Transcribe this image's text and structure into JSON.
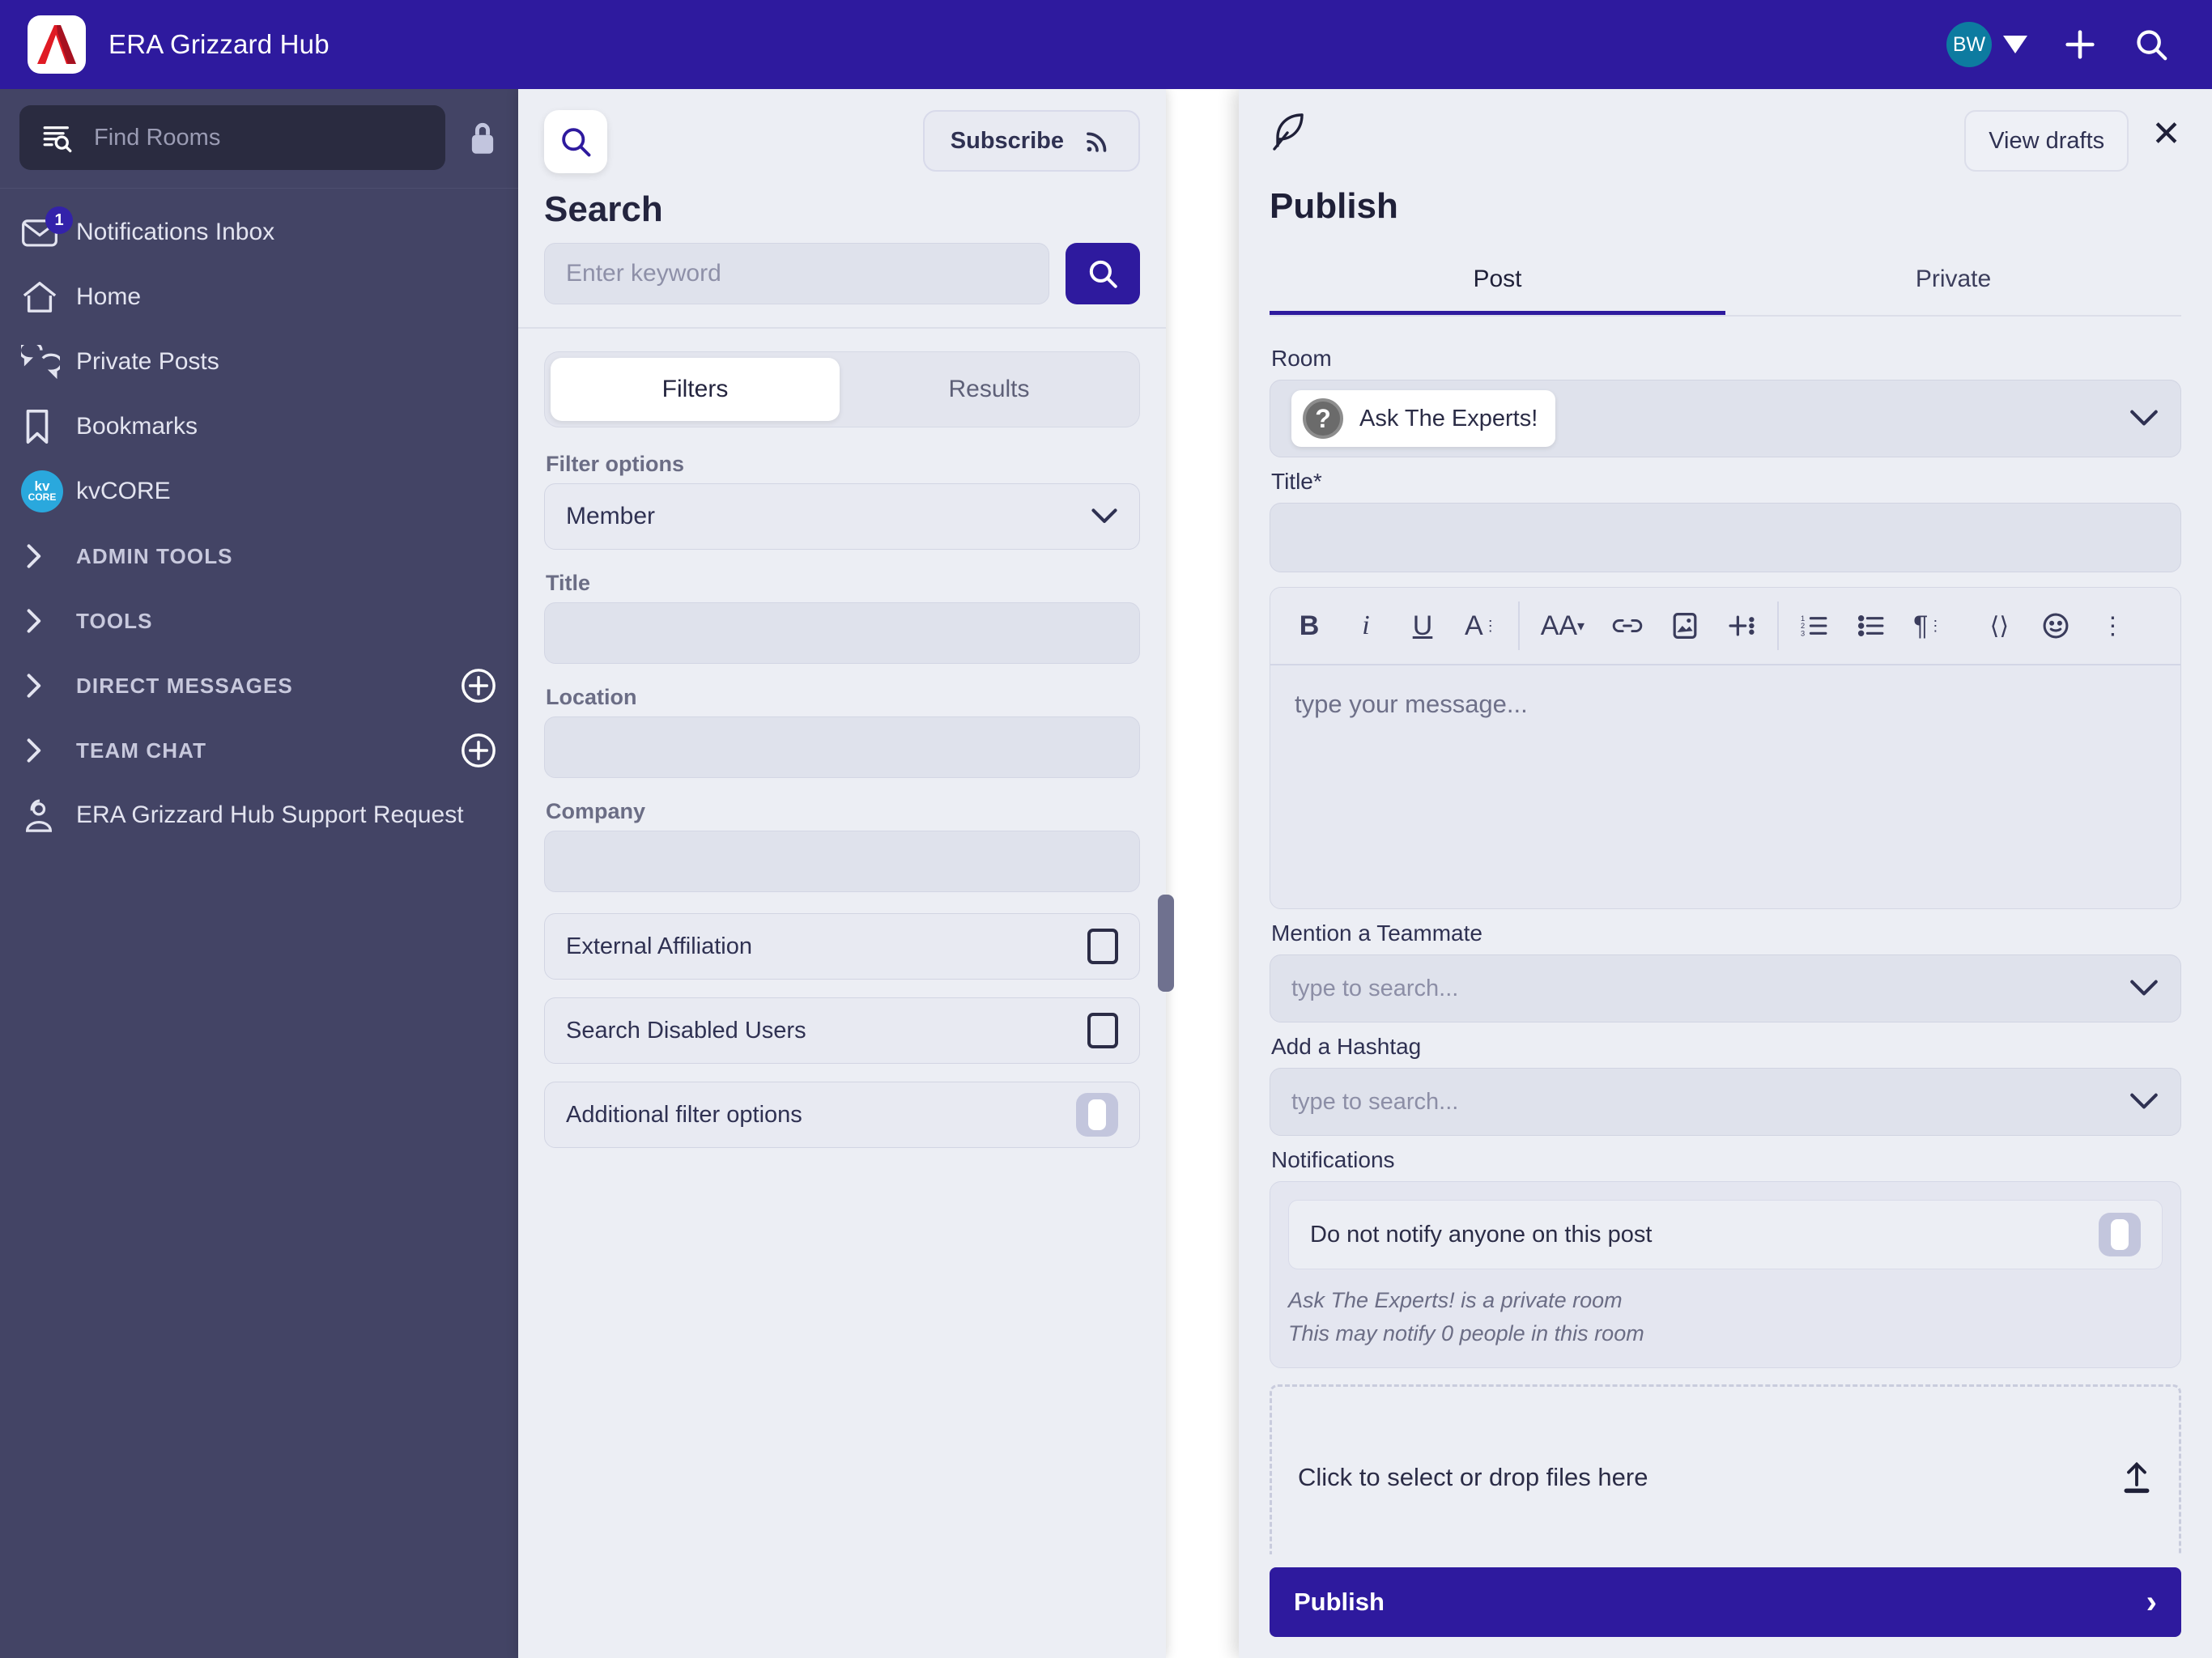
{
  "topbar": {
    "app_title": "ERA Grizzard Hub",
    "avatar_initials": "BW",
    "icons": [
      "caret-down-icon",
      "plus-icon",
      "search-icon"
    ],
    "brand_color": "#2e1a9e"
  },
  "sidebar": {
    "find_rooms_placeholder": "Find Rooms",
    "lock_icon": "lock-icon",
    "items": [
      {
        "label": "Notifications Inbox",
        "icon": "envelope-icon",
        "badge": "1"
      },
      {
        "label": "Home",
        "icon": "home-icon"
      },
      {
        "label": "Private Posts",
        "icon": "chat-bubbles-icon"
      },
      {
        "label": "Bookmarks",
        "icon": "bookmark-icon"
      },
      {
        "label": "kvCORE",
        "icon": "kvcore-logo-icon"
      },
      {
        "label": "ADMIN TOOLS",
        "icon": "chevron-right-icon",
        "section": true
      },
      {
        "label": "TOOLS",
        "icon": "chevron-right-icon",
        "section": true
      },
      {
        "label": "DIRECT MESSAGES",
        "icon": "chevron-right-icon",
        "section": true,
        "add": "plus-circle-icon"
      },
      {
        "label": "TEAM CHAT",
        "icon": "chevron-right-icon",
        "section": true,
        "add": "plus-circle-icon"
      },
      {
        "label": "ERA Grizzard Hub Support Request",
        "icon": "support-agent-icon"
      }
    ],
    "background": "#434465"
  },
  "search_panel": {
    "header_icon": "search-icon",
    "subscribe_label": "Subscribe",
    "subscribe_icon": "rss-icon",
    "title": "Search",
    "keyword_placeholder": "Enter keyword",
    "go_icon": "search-icon",
    "tabs": [
      {
        "label": "Filters",
        "active": true
      },
      {
        "label": "Results",
        "active": false
      }
    ],
    "filter_options_label": "Filter options",
    "filter_options_value": "Member",
    "fields": [
      {
        "label": "Title",
        "value": ""
      },
      {
        "label": "Location",
        "value": ""
      },
      {
        "label": "Company",
        "value": ""
      }
    ],
    "checkboxes": [
      {
        "label": "External Affiliation",
        "checked": false,
        "control": "checkbox"
      },
      {
        "label": "Search Disabled Users",
        "checked": false,
        "control": "checkbox"
      },
      {
        "label": "Additional filter options",
        "checked": false,
        "control": "toggle"
      }
    ]
  },
  "publish": {
    "feather_icon": "feather-icon",
    "view_drafts_label": "View drafts",
    "close_icon": "close-icon",
    "title": "Publish",
    "tabs": [
      {
        "label": "Post",
        "active": true
      },
      {
        "label": "Private",
        "active": false
      }
    ],
    "room_label": "Room",
    "room_value": "Ask The Experts!",
    "room_icon": "question-mark-icon",
    "title_label": "Title*",
    "title_value": "",
    "toolbar": [
      {
        "name": "bold-icon",
        "glyph": "B"
      },
      {
        "name": "italic-icon",
        "glyph": "i"
      },
      {
        "name": "underline-icon",
        "glyph": "U"
      },
      {
        "name": "text-style-icon",
        "glyph": "A"
      },
      {
        "name": "font-size-icon",
        "glyph": "AA"
      },
      {
        "name": "link-icon",
        "glyph": "link"
      },
      {
        "name": "image-icon",
        "glyph": "image"
      },
      {
        "name": "insert-icon",
        "glyph": "plus"
      },
      {
        "name": "ordered-list-icon",
        "glyph": "ol"
      },
      {
        "name": "bulleted-list-icon",
        "glyph": "ul"
      },
      {
        "name": "paragraph-icon",
        "glyph": "pilcrow"
      },
      {
        "name": "code-icon",
        "glyph": "<>"
      },
      {
        "name": "emoji-icon",
        "glyph": "smiley"
      },
      {
        "name": "more-options-icon",
        "glyph": "kebab"
      }
    ],
    "message_placeholder": "type your message...",
    "mention_label": "Mention a Teammate",
    "mention_placeholder": "type to search...",
    "hashtag_label": "Add a Hashtag",
    "hashtag_placeholder": "type to search...",
    "notifications_label": "Notifications",
    "do_not_notify_label": "Do not notify anyone on this post",
    "do_not_notify_on": false,
    "note_line_1": "Ask The Experts! is a private room",
    "note_line_2": "This may notify 0 people in this room",
    "dropzone_label": "Click to select or drop files here",
    "dropzone_icon": "upload-icon",
    "publish_label": "Publish",
    "publish_arrow_icon": "chevron-right-icon"
  }
}
